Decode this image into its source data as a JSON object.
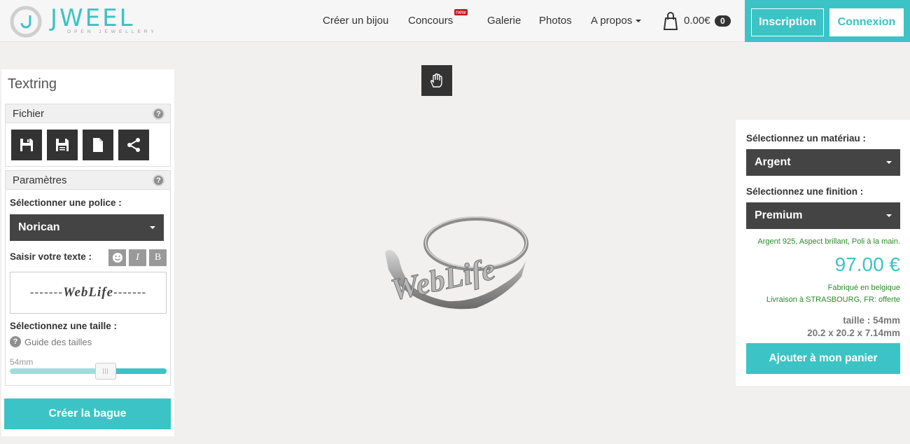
{
  "brand": {
    "name": "JWEEL",
    "tagline": "OPEN JEWELLERY"
  },
  "nav": {
    "create": "Créer un bijou",
    "contest": "Concours",
    "contest_badge": "new",
    "gallery": "Galerie",
    "photos": "Photos",
    "about": "A propos",
    "cart_amount": "0.00€",
    "cart_count": "0"
  },
  "auth": {
    "signup": "Inscription",
    "login": "Connexion"
  },
  "left": {
    "title": "Textring",
    "file": {
      "title": "Fichier",
      "help": "?"
    },
    "params": {
      "title": "Paramètres",
      "help": "?",
      "font_label": "Sélectionner une police :",
      "font_value": "Norican",
      "text_label": "Saisir votre texte :",
      "fmt_italic": "I",
      "fmt_bold": "B",
      "text_prefix": "-------",
      "text_value": "WebLife",
      "text_suffix": "-------",
      "size_label": "Sélectionnez une taille :",
      "size_guide": "Guide des tailles",
      "size_value": "54mm",
      "slider_fraction": 0.61
    },
    "create_button": "Créer la bague"
  },
  "right": {
    "material_label": "Sélectionnez un matériau :",
    "material_value": "Argent",
    "finish_label": "Sélectionnez une finition :",
    "finish_value": "Premium",
    "finish_desc": "Argent 925, Aspect brillant, Poli à la main.",
    "price": "97.00 €",
    "made_in": "Fabriqué en belgique",
    "delivery": "Livraison à STRASBOURG, FR: offerte",
    "size": "taille : 54mm",
    "dimensions": "20.2 x 20.2 x 7.14mm",
    "add_to_cart": "Ajouter à mon panier"
  },
  "colors": {
    "accent": "#3cc3c5",
    "dark": "#333333",
    "success": "#2a8a2a",
    "badge": "#c8101a"
  },
  "icons": {
    "file": [
      "save-icon",
      "save-as-icon",
      "new-document-icon",
      "share-icon"
    ],
    "center": "hand-icon",
    "cart": "shopping-bag-icon"
  }
}
